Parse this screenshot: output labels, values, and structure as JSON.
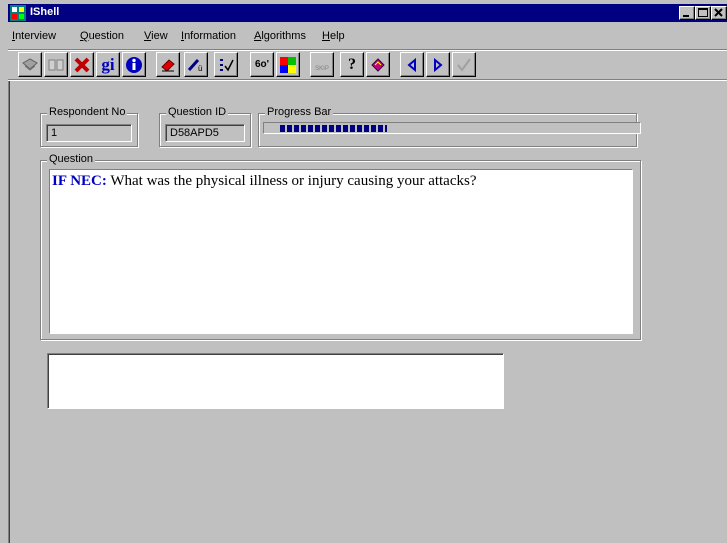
{
  "window": {
    "title": "IShell"
  },
  "menu": [
    {
      "mnemonic": "I",
      "rest": "nterview"
    },
    {
      "mnemonic": "Q",
      "rest": "uestion"
    },
    {
      "mnemonic": "V",
      "rest": "iew"
    },
    {
      "mnemonic": "I",
      "rest": "nformation"
    },
    {
      "mnemonic": "A",
      "rest": "lgorithms"
    },
    {
      "mnemonic": "H",
      "rest": "elp"
    }
  ],
  "toolbar": {
    "gi_label": "gi",
    "skip_label": "SKIP",
    "glasses_label": "6o'",
    "help_label": "?"
  },
  "fields": {
    "respondent_label": "Respondent No",
    "respondent_value": "1",
    "question_id_label": "Question ID",
    "question_id_value": "D58APD5",
    "progress_label": "Progress Bar",
    "progress_fraction": 0.29
  },
  "question": {
    "group_label": "Question",
    "prefix": "IF NEC:",
    "text": " What was the physical illness or injury causing your attacks?"
  },
  "answer": {
    "value": ""
  }
}
